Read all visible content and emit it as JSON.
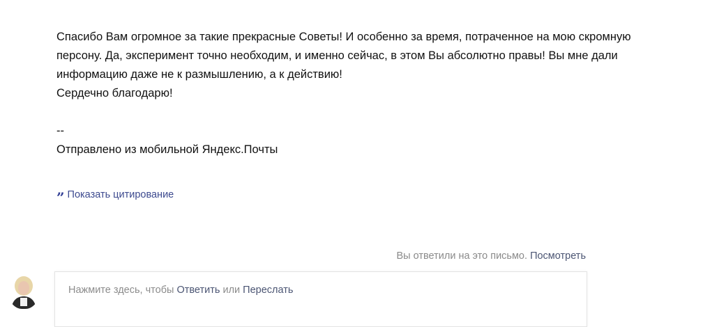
{
  "message": {
    "paragraph1": "Спасибо Вам огромное за такие прекрасные Советы! И особенно за время, потраченное на мою скромную",
    "paragraph1b": "персону. Да, эксперимент точно необходим, и именно сейчас, в этом Вы абсолютно правы! Вы мне дали",
    "paragraph1c": "информацию даже не к размышлению, а к действию!",
    "thanks": "Сердечно благодарю!",
    "signature_separator": "--",
    "signature": "Отправлено из мобильной Яндекс.Почты"
  },
  "quote_toggle": {
    "icon": "quote-icon",
    "label": "Показать цитирование"
  },
  "replied_note": {
    "text": "Вы ответили на это письмо.",
    "link": "Посмотреть"
  },
  "reply_box": {
    "prefix": "Нажмите здесь, чтобы",
    "reply_link": "Ответить",
    "middle": "или",
    "forward_link": "Переслать"
  },
  "colors": {
    "link": "#4b5573",
    "quote_link": "#3d4a8f",
    "muted_text": "#8c8c8c"
  }
}
